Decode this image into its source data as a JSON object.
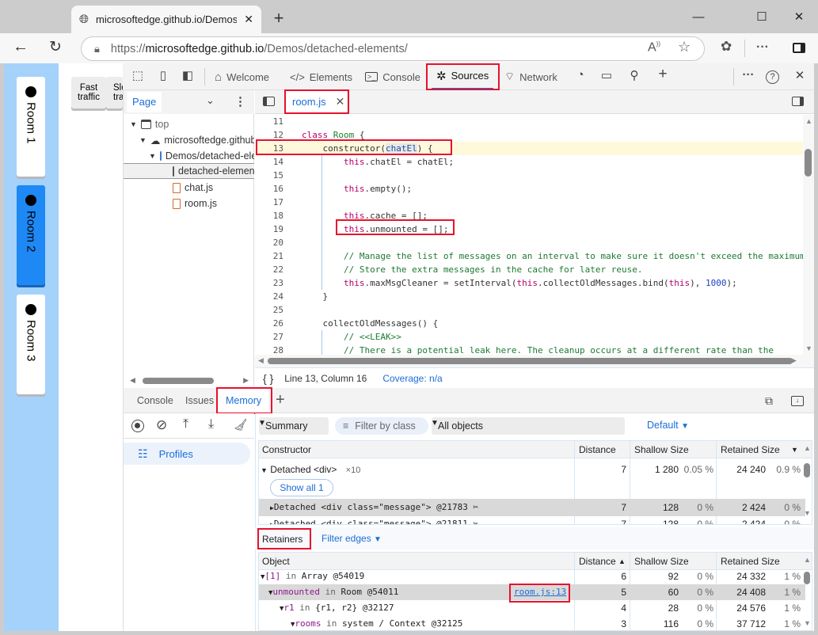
{
  "browser": {
    "tab_title": "microsoftedge.github.io/Demos/detached-elements/",
    "new_tab": "+",
    "window_controls": {
      "minimize": "—",
      "maximize": "☐",
      "close": "✕"
    },
    "address": {
      "scheme": "https://",
      "host": "microsoftedge.github.io",
      "path": "/Demos/detached-elements/"
    },
    "icons": [
      "globe-icon",
      "back-icon",
      "reload-icon",
      "lock-icon",
      "read-aloud-icon",
      "favorite-icon",
      "extensions-icon",
      "more-icon",
      "sidebar-icon"
    ]
  },
  "page": {
    "traffic_buttons": [
      "Fast traffic",
      "Slow traffic"
    ],
    "rooms": [
      {
        "label": "Room 1",
        "active": false
      },
      {
        "label": "Room 2",
        "active": true
      },
      {
        "label": "Room 3",
        "active": false
      }
    ]
  },
  "devtools": {
    "tabs": [
      {
        "label": "Welcome",
        "icon": "home-icon"
      },
      {
        "label": "Elements",
        "icon": "code-icon"
      },
      {
        "label": "Console",
        "icon": "console-icon"
      },
      {
        "label": "Sources",
        "icon": "bug-icon",
        "active": true
      },
      {
        "label": "Network",
        "icon": "wifi-icon"
      }
    ],
    "navigator": {
      "tab": "Page",
      "tree": [
        {
          "label": "top",
          "level": 0
        },
        {
          "label": "microsoftedge.github.io",
          "level": 1
        },
        {
          "label": "Demos/detached-elements",
          "level": 2
        },
        {
          "label": "detached-elements",
          "level": 3,
          "selected": true
        },
        {
          "label": "chat.js",
          "level": 3
        },
        {
          "label": "room.js",
          "level": 3
        }
      ]
    },
    "editor": {
      "file_tab": "room.js",
      "status": {
        "braces": "{ }",
        "position": "Line 13, Column 16",
        "coverage": "Coverage: n/a"
      }
    },
    "drawer": {
      "tabs": [
        "Console",
        "Issues",
        "Memory"
      ],
      "active_tab": "Memory",
      "profiles_label": "Profiles",
      "view_select": "Summary",
      "filter_placeholder": "Filter by class",
      "objects_select": "All objects",
      "default_select": "Default",
      "summary": {
        "headers": [
          "Constructor",
          "Distance",
          "Shallow Size",
          "Retained Size"
        ],
        "rows": [
          {
            "name": "Detached <div>",
            "count": "×10",
            "distance": "7",
            "shallow": "1 280",
            "shallow_pct": "0.05 %",
            "retained": "24 240",
            "retained_pct": "0.9 %"
          },
          {
            "button": "Show all 1"
          },
          {
            "name": "Detached <div class=\"message\"> @21783",
            "distance": "7",
            "shallow": "128",
            "shallow_pct": "0 %",
            "retained": "2 424",
            "retained_pct": "0 %",
            "selected": true
          },
          {
            "name": "Detached <div class=\"message\"> @21811",
            "distance": "7",
            "shallow": "128",
            "shallow_pct": "0 %",
            "retained": "2 424",
            "retained_pct": "0 %"
          }
        ]
      },
      "retainers": {
        "label": "Retainers",
        "filter_edges": "Filter edges",
        "headers": [
          "Object",
          "Distance",
          "Shallow Size",
          "Retained Size"
        ],
        "rows": [
          {
            "edge": "[1]",
            "in": "in",
            "obj": "Array @54019",
            "distance": "6",
            "shallow": "92",
            "shallow_pct": "0 %",
            "retained": "24 332",
            "retained_pct": "1 %"
          },
          {
            "edge": "unmounted",
            "in": "in",
            "obj": "Room @54011",
            "link": "room.js:13",
            "distance": "5",
            "shallow": "60",
            "shallow_pct": "0 %",
            "retained": "24 408",
            "retained_pct": "1 %",
            "selected": true
          },
          {
            "edge": "r1",
            "in": "in",
            "obj": "{r1, r2} @32127",
            "distance": "4",
            "shallow": "28",
            "shallow_pct": "0 %",
            "retained": "24 576",
            "retained_pct": "1 %"
          },
          {
            "edge": "rooms",
            "in": "in",
            "obj": "system / Context @32125",
            "distance": "3",
            "shallow": "116",
            "shallow_pct": "0 %",
            "retained": "37 712",
            "retained_pct": "1 %"
          }
        ]
      }
    }
  }
}
